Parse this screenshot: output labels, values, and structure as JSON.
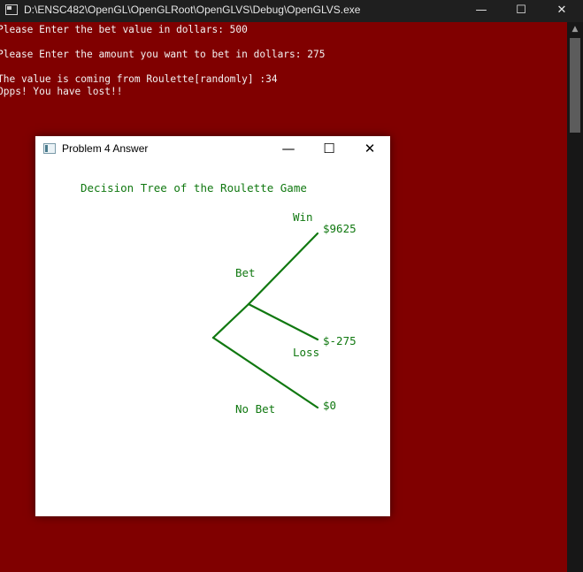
{
  "console": {
    "title": "D:\\ENSC482\\OpenGL\\OpenGLRoot\\OpenGLVS\\Debug\\OpenGLVS.exe",
    "lines": [
      "Please Enter the bet value in dollars: 500",
      "Please Enter the amount you want to bet in dollars: 275",
      "The value is coming from Roulette[randomly] :34",
      "Opps! You have lost!!"
    ],
    "controls": {
      "minimize": "—",
      "maximize": "☐",
      "close": "✕"
    }
  },
  "child_window": {
    "title": "Problem 4 Answer",
    "controls": {
      "minimize": "—",
      "maximize": "☐",
      "close": "✕"
    }
  },
  "tree": {
    "title": "Decision Tree of the Roulette Game",
    "labels": {
      "win": "Win",
      "bet": "Bet",
      "loss": "Loss",
      "no_bet": "No Bet"
    },
    "values": {
      "win": "$9625",
      "loss": "$-275",
      "no_bet": "$0"
    },
    "color": "#107810"
  }
}
